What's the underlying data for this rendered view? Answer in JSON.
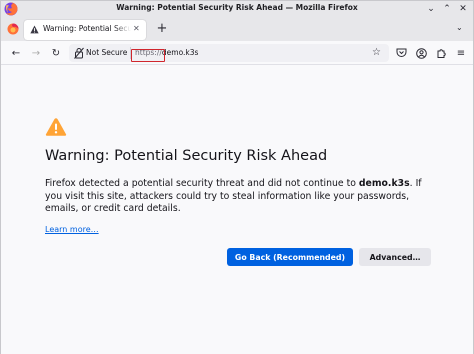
{
  "window": {
    "title": "Warning: Potential Security Risk Ahead — Mozilla Firefox"
  },
  "tabs": [
    {
      "label": "Warning: Potential Security Risk Ahead",
      "icon": "warning-icon"
    }
  ],
  "urlbar": {
    "security_label": "Not Secure",
    "url_scheme": "https://",
    "url_host": "demo.k3s"
  },
  "page": {
    "heading": "Warning: Potential Security Risk Ahead",
    "desc_before": "Firefox detected a potential security threat and did not continue to ",
    "desc_domain": "demo.k3s",
    "desc_after": ". If you visit this site, attackers could try to steal information like your passwords, emails, or credit card details.",
    "learn_more": "Learn more…",
    "primary_button": "Go Back (Recommended)",
    "secondary_button": "Advanced…"
  },
  "colors": {
    "accent": "#0061e0",
    "warning": "#ffa436",
    "highlight_box": "#d0262d"
  }
}
